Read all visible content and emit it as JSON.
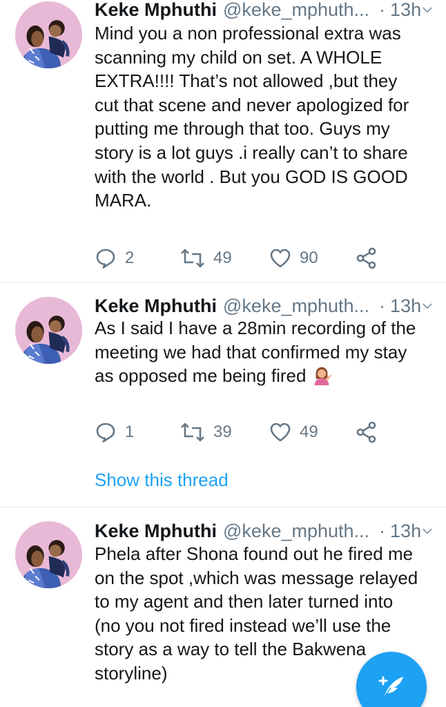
{
  "colors": {
    "accent": "#1da1f2",
    "muted": "#657786",
    "text": "#14171a",
    "divider": "#e1e8ed"
  },
  "icons": {
    "reply": "speech-bubble-icon",
    "retweet": "retweet-arrows-icon",
    "like": "heart-icon",
    "share": "share-nodes-icon",
    "caret": "chevron-down-icon",
    "compose": "compose-feather-icon",
    "emoji": "woman-tipping-hand-emoji"
  },
  "tweets": [
    {
      "name": "Keke Mphuthi",
      "handle": "@keke_mphuth...",
      "dot": "·",
      "time": "13h",
      "text": "Mind you a non professional extra was\nscanning my child on set. A WHOLE\nEXTRA!!!! That’s not allowed ,but they\ncut that scene and never apologized for\nputting me through that too. Guys my\nstory is a lot guys .i really can’t to share\nwith the world . But you GOD IS GOOD\nMARA.",
      "replies": "2",
      "retweets": "49",
      "likes": "90"
    },
    {
      "name": "Keke Mphuthi",
      "handle": "@keke_mphuth...",
      "dot": "·",
      "time": "13h",
      "text": "As I said I have a 28min recording of the\nmeeting we had that confirmed my stay\nas opposed me being fired",
      "replies": "1",
      "retweets": "39",
      "likes": "49",
      "thread_link": "Show this thread"
    },
    {
      "name": "Keke Mphuthi",
      "handle": "@keke_mphuth...",
      "dot": "·",
      "time": "13h",
      "text": "Phela after Shona found out he fired me\non the spot ,which was message relayed\nto my agent and then later turned into\n(no you not fired instead we’ll use the\nstory as a way to tell the Bakwena\nstoryline)"
    }
  ]
}
